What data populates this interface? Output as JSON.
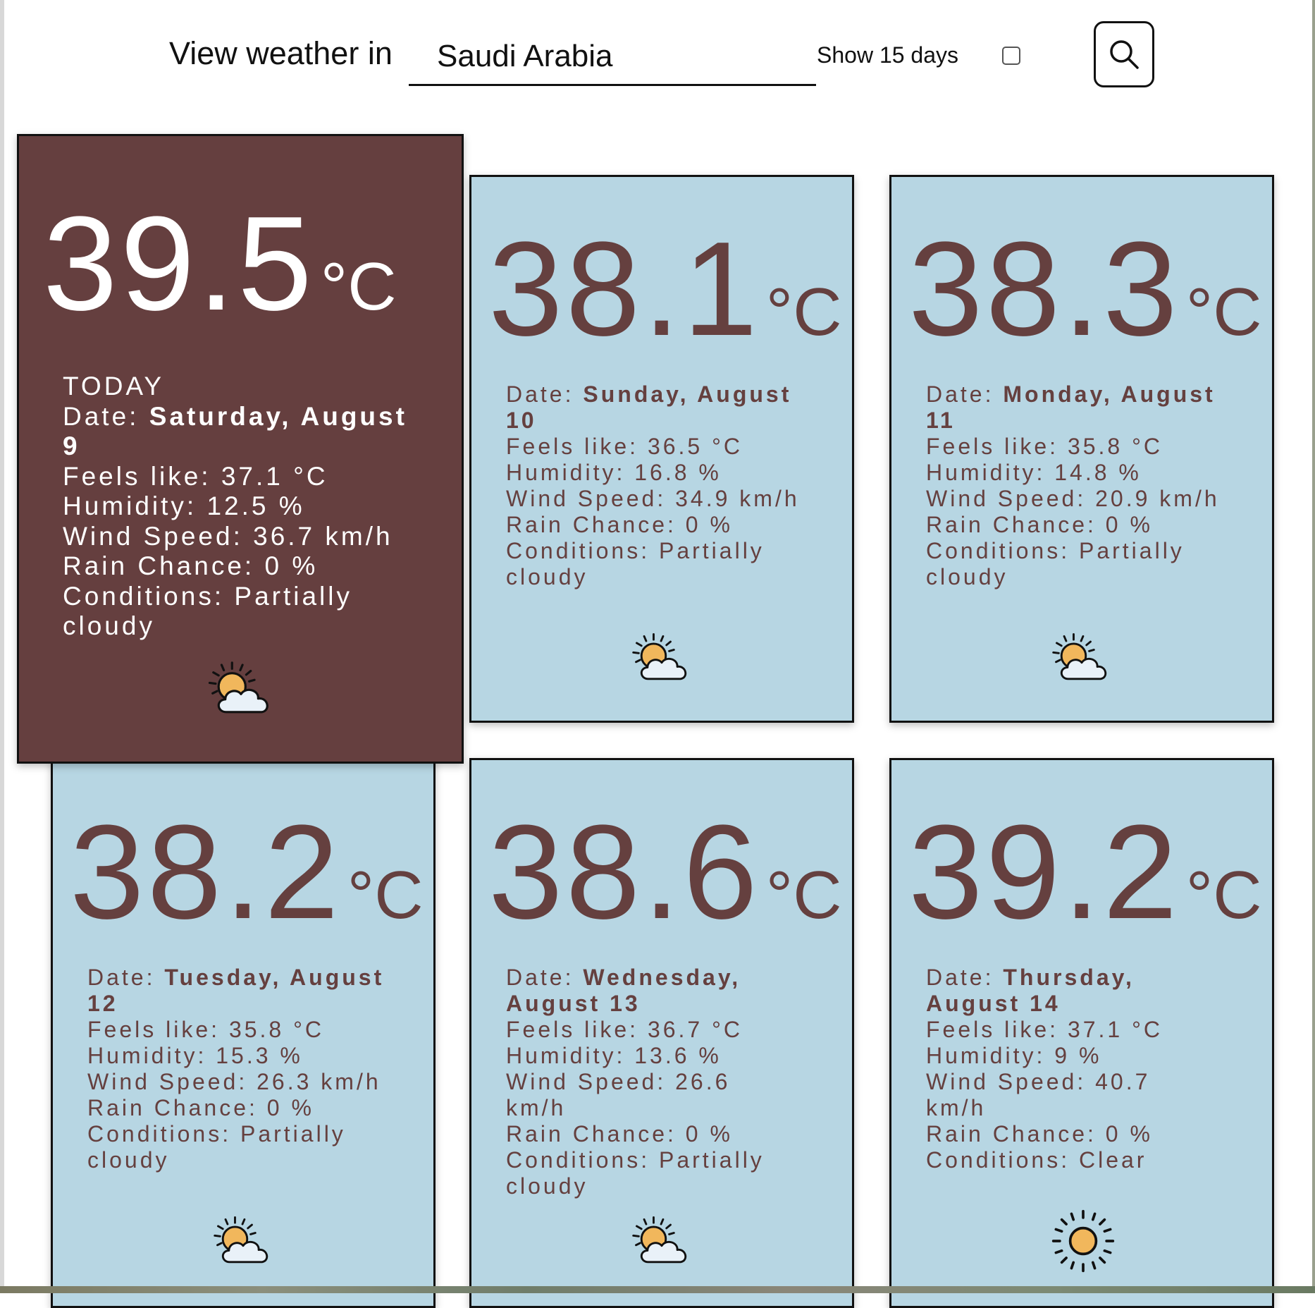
{
  "header": {
    "label": "View weather in",
    "location_value": "Saudi Arabia",
    "days_toggle_label": "Show 15 days",
    "days_toggle_checked": false
  },
  "colors": {
    "today_card_bg": "#653f3f",
    "card_bg": "#b7d6e3",
    "card_text": "#65403f"
  },
  "forecast": [
    {
      "today_label": "TODAY",
      "temp": "39.5",
      "unit": "°C",
      "date_label": "Date: ",
      "date": "Saturday, August 9",
      "feels_like": "Feels like: 37.1 °C",
      "humidity": "Humidity: 12.5 %",
      "wind": "Wind Speed: 36.7 km/h",
      "rain": "Rain Chance: 0 %",
      "conditions": "Conditions: Partially cloudy",
      "icon": "partly-cloudy-icon"
    },
    {
      "temp": "38.1",
      "unit": "°C",
      "date_label": "Date: ",
      "date": "Sunday, August 10",
      "feels_like": "Feels like: 36.5 °C",
      "humidity": "Humidity: 16.8 %",
      "wind": "Wind Speed: 34.9 km/h",
      "rain": "Rain Chance: 0 %",
      "conditions": "Conditions: Partially cloudy",
      "icon": "partly-cloudy-icon"
    },
    {
      "temp": "38.3",
      "unit": "°C",
      "date_label": "Date: ",
      "date": "Monday, August 11",
      "feels_like": "Feels like: 35.8 °C",
      "humidity": "Humidity: 14.8 %",
      "wind": "Wind Speed: 20.9 km/h",
      "rain": "Rain Chance: 0 %",
      "conditions": "Conditions: Partially cloudy",
      "icon": "partly-cloudy-icon"
    },
    {
      "temp": "38.2",
      "unit": "°C",
      "date_label": "Date: ",
      "date": "Tuesday, August 12",
      "feels_like": "Feels like: 35.8 °C",
      "humidity": "Humidity: 15.3 %",
      "wind": "Wind Speed: 26.3 km/h",
      "rain": "Rain Chance: 0 %",
      "conditions": "Conditions: Partially cloudy",
      "icon": "partly-cloudy-icon"
    },
    {
      "temp": "38.6",
      "unit": "°C",
      "date_label": "Date: ",
      "date": "Wednesday, August 13",
      "feels_like": "Feels like: 36.7 °C",
      "humidity": "Humidity: 13.6 %",
      "wind": "Wind Speed: 26.6 km/h",
      "rain": "Rain Chance: 0 %",
      "conditions": "Conditions: Partially cloudy",
      "icon": "partly-cloudy-icon"
    },
    {
      "temp": "39.2",
      "unit": "°C",
      "date_label": "Date: ",
      "date": "Thursday, August 14",
      "feels_like": "Feels like: 37.1 °C",
      "humidity": "Humidity: 9 %",
      "wind": "Wind Speed: 40.7 km/h",
      "rain": "Rain Chance: 0 %",
      "conditions": "Conditions: Clear",
      "icon": "sun-icon"
    }
  ]
}
